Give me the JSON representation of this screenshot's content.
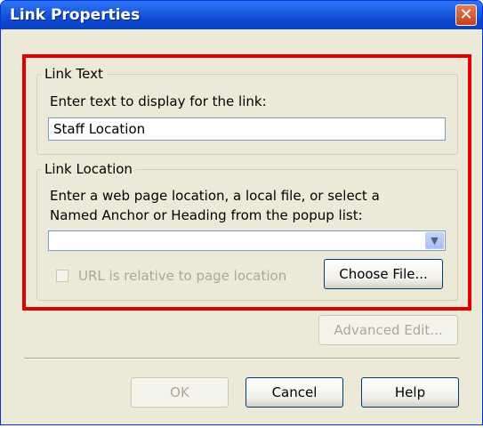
{
  "window": {
    "title": "Link Properties",
    "close_glyph": "✕"
  },
  "link_text": {
    "legend": "Link Text",
    "prompt": "Enter text to display for the link:",
    "value": "Staff Location"
  },
  "link_location": {
    "legend": "Link Location",
    "prompt_line1": "Enter a web page location, a local file, or select a",
    "prompt_line2": "Named Anchor or Heading from the popup list:",
    "url_value": "",
    "relative_label": "URL is relative to page location",
    "relative_checked": false,
    "choose_file_label": "Choose File..."
  },
  "buttons": {
    "advanced_edit": "Advanced Edit...",
    "ok": "OK",
    "cancel": "Cancel",
    "help": "Help"
  },
  "icons": {
    "dropdown": "chevron-down-icon",
    "close": "close-icon"
  },
  "colors": {
    "highlight_frame": "#e10000",
    "titlebar": "#0a48d0",
    "dialog_bg": "#ece9d8"
  }
}
